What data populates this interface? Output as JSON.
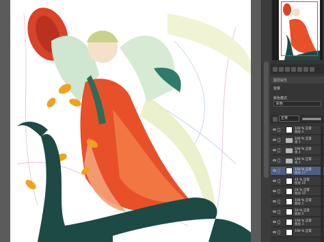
{
  "navigator": {
    "toolbar_icons": [
      "zoom-out-icon",
      "zoom-in-icon",
      "fit-icon",
      "actual-size-icon",
      "rotate-left-icon",
      "rotate-right-icon",
      "flip-icon"
    ]
  },
  "panel": {
    "tab_label": "图层属性",
    "effect_label": "效果",
    "color_label": "颜色模式",
    "color_value": "彩色"
  },
  "layer_toolbar": {
    "blend_mode": "正常",
    "opacity_percent": 100
  },
  "layers": [
    {
      "line1": "100 % 正常",
      "line2": "图层 4",
      "type": "raster",
      "selected": false
    },
    {
      "line1": "100 % 正常",
      "line2": "组 3",
      "type": "folder",
      "selected": false
    },
    {
      "line1": "100 % 正常",
      "line2": "组 4",
      "type": "folder",
      "selected": false
    },
    {
      "line1": "100 % 正常",
      "line2": "组 2",
      "type": "folder",
      "selected": false
    },
    {
      "line1": "100 % 正常",
      "line2": "图层 17",
      "type": "raster",
      "selected": true
    },
    {
      "line1": "41 % 正常",
      "line2": "图层 16",
      "type": "raster",
      "selected": false
    },
    {
      "line1": "24 % 正常",
      "line2": "图层 24",
      "type": "raster",
      "selected": false
    },
    {
      "line1": "100 % 正常",
      "line2": "图层 5",
      "type": "raster",
      "selected": false
    },
    {
      "line1": "19 % 正常",
      "line2": "图层 6",
      "type": "raster",
      "selected": false
    },
    {
      "line1": "100 % 正常",
      "line2": "图层 3",
      "type": "raster",
      "selected": false
    },
    {
      "line1": "100 % 正常",
      "line2": "",
      "type": "raster",
      "selected": false
    }
  ]
}
